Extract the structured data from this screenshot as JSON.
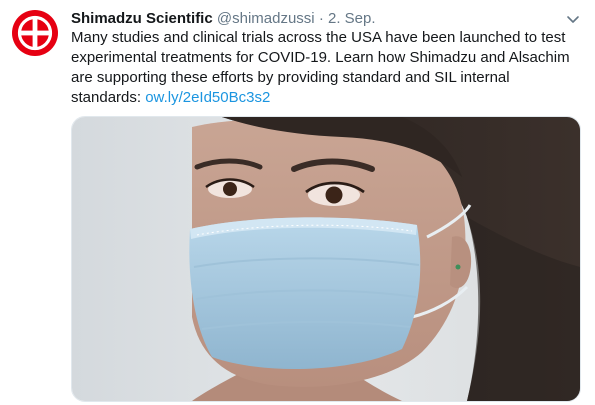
{
  "tweet": {
    "display_name": "Shimadzu Scientific",
    "handle": "@shimadzussi",
    "separator": "·",
    "date": "2. Sep.",
    "text": "Many studies and clinical trials across the USA have been launched to test experimental treatments for COVID-19. Learn how Shimadzu and Alsachim are supporting these efforts by providing standard and SIL internal standards: ",
    "link_text": "ow.ly/2eId50Bc3s2"
  },
  "colors": {
    "brand_red": "#e60012",
    "link": "#1b95e0",
    "secondary_text": "#657786"
  },
  "icons": {
    "avatar": "shimadzu-logo",
    "menu": "chevron-down-icon"
  }
}
